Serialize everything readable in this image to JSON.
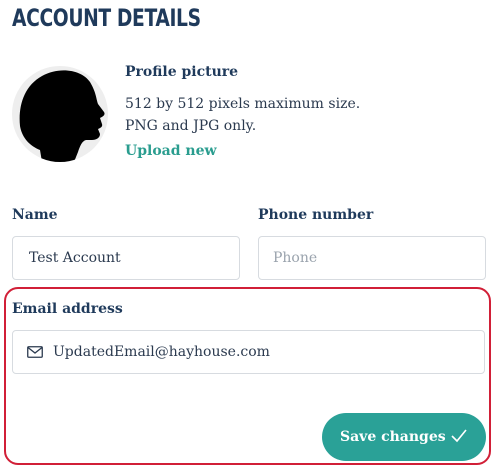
{
  "page": {
    "title": "ACCOUNT DETAILS"
  },
  "profile": {
    "label": "Profile picture",
    "desc_line1": "512 by 512 pixels maximum size.",
    "desc_line2": "PNG and JPG only.",
    "upload_label": "Upload new",
    "avatar_icon": "silhouette-head-icon"
  },
  "form": {
    "name_label": "Name",
    "name_value": "Test Account",
    "phone_label": "Phone number",
    "phone_placeholder": "Phone",
    "email_label": "Email address",
    "email_value": "UpdatedEmail@hayhouse.com",
    "email_icon": "mail-icon",
    "save_label": "Save changes",
    "save_icon": "check-icon"
  },
  "colors": {
    "heading": "#1f3a5b",
    "accent": "#2aa197",
    "highlight_border": "#d11f37",
    "field_border": "#d7dbe0"
  }
}
